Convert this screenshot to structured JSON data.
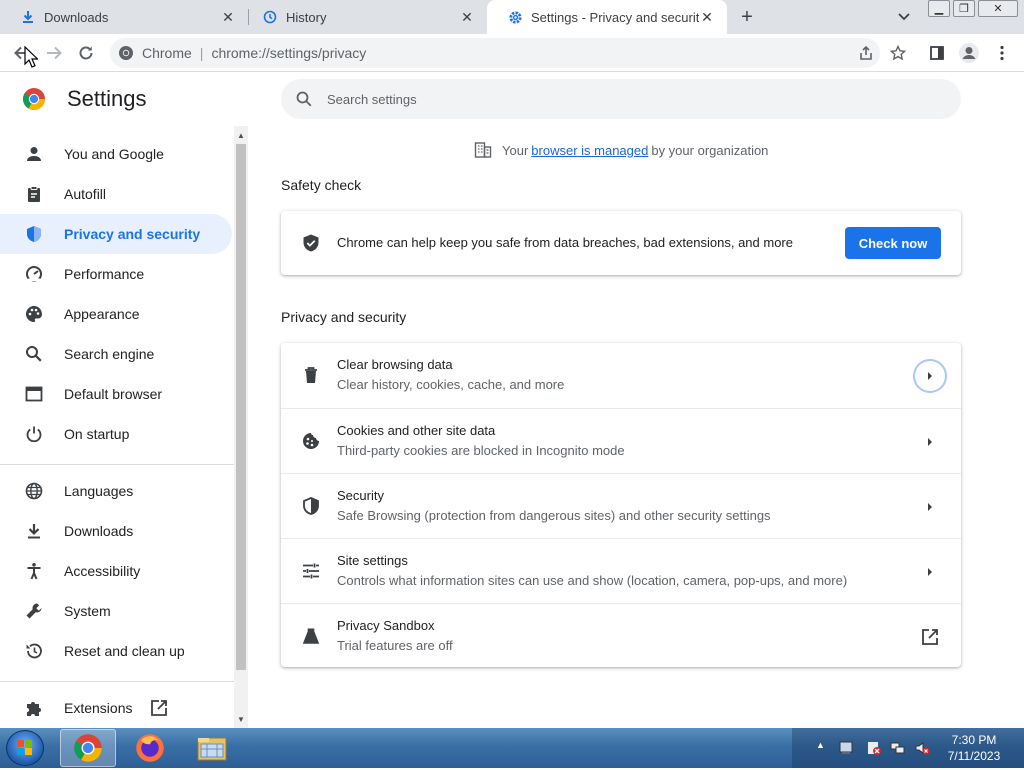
{
  "tabs": [
    {
      "title": "Downloads",
      "icon": "download-icon"
    },
    {
      "title": "History",
      "icon": "history-icon"
    },
    {
      "title": "Settings - Privacy and security",
      "icon": "gear-icon"
    }
  ],
  "omnibox": {
    "site": "Chrome",
    "url": "chrome://settings/privacy"
  },
  "settings": {
    "title": "Settings",
    "search_placeholder": "Search settings"
  },
  "sidebar": {
    "items": [
      {
        "label": "You and Google",
        "icon": "person-icon"
      },
      {
        "label": "Autofill",
        "icon": "clipboard-icon"
      },
      {
        "label": "Privacy and security",
        "icon": "shield-icon",
        "active": true
      },
      {
        "label": "Performance",
        "icon": "gauge-icon"
      },
      {
        "label": "Appearance",
        "icon": "palette-icon"
      },
      {
        "label": "Search engine",
        "icon": "search-icon"
      },
      {
        "label": "Default browser",
        "icon": "browser-window-icon"
      },
      {
        "label": "On startup",
        "icon": "power-icon"
      },
      {
        "label": "Languages",
        "icon": "globe-icon"
      },
      {
        "label": "Downloads",
        "icon": "download-icon"
      },
      {
        "label": "Accessibility",
        "icon": "accessibility-icon"
      },
      {
        "label": "System",
        "icon": "wrench-icon"
      },
      {
        "label": "Reset and clean up",
        "icon": "restore-icon"
      },
      {
        "label": "Extensions",
        "icon": "puzzle-icon"
      }
    ]
  },
  "managed": {
    "before": "Your",
    "link": "browser is managed",
    "after": "by your organization"
  },
  "safety_check": {
    "heading": "Safety check",
    "text": "Chrome can help keep you safe from data breaches, bad extensions, and more",
    "button": "Check now"
  },
  "privacy": {
    "heading": "Privacy and security",
    "rows": [
      {
        "title": "Clear browsing data",
        "sub": "Clear history, cookies, cache, and more"
      },
      {
        "title": "Cookies and other site data",
        "sub": "Third-party cookies are blocked in Incognito mode"
      },
      {
        "title": "Security",
        "sub": "Safe Browsing (protection from dangerous sites) and other security settings"
      },
      {
        "title": "Site settings",
        "sub": "Controls what information sites can use and show (location, camera, pop-ups, and more)"
      },
      {
        "title": "Privacy Sandbox",
        "sub": "Trial features are off"
      }
    ]
  },
  "taskbar": {
    "time": "7:30 PM",
    "date": "7/11/2023"
  },
  "colors": {
    "accent": "#1a73e8",
    "active_nav_bg": "#e8f0fe"
  }
}
